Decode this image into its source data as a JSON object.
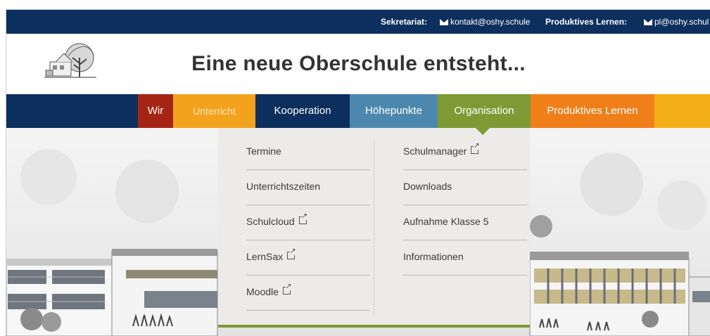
{
  "topbar": {
    "sekretariat_label": "Sekretariat:",
    "sekretariat_email": "kontakt@oshy.schule",
    "pl_label": "Produktives Lernen:",
    "pl_email": "pl@oshy.schul",
    "email_icon": "envelope-icon"
  },
  "header": {
    "title": "Eine neue Oberschule entsteht...",
    "logo_icon": "school-tree-logo"
  },
  "nav": {
    "tabs": [
      {
        "label": "Wir",
        "color": "#a52515"
      },
      {
        "label": "Unterricht",
        "color": "#f3a21e"
      },
      {
        "label": "Kooperation",
        "color": "#0d2f5e"
      },
      {
        "label": "Höhepunkte",
        "color": "#4c88ad"
      },
      {
        "label": "Organisation",
        "color": "#7e9a35"
      },
      {
        "label": "Produktives Lernen",
        "color": "#f07f1a"
      },
      {
        "label": "",
        "color": "#f4ae17"
      }
    ],
    "bar_color": "#0d2f5e"
  },
  "dropdown": {
    "left": [
      {
        "label": "Termine",
        "external": false
      },
      {
        "label": "Unterrichtszeiten",
        "external": false
      },
      {
        "label": "Schulcloud",
        "external": true
      },
      {
        "label": "LernSax",
        "external": true
      },
      {
        "label": "Moodle",
        "external": true
      }
    ],
    "right": [
      {
        "label": "Schulmanager",
        "external": true
      },
      {
        "label": "Downloads",
        "external": false
      },
      {
        "label": "Aufnahme Klasse 5",
        "external": false
      },
      {
        "label": "Informationen",
        "external": false
      }
    ],
    "external_icon": "external-link-icon",
    "accent": "#7e9a35"
  }
}
